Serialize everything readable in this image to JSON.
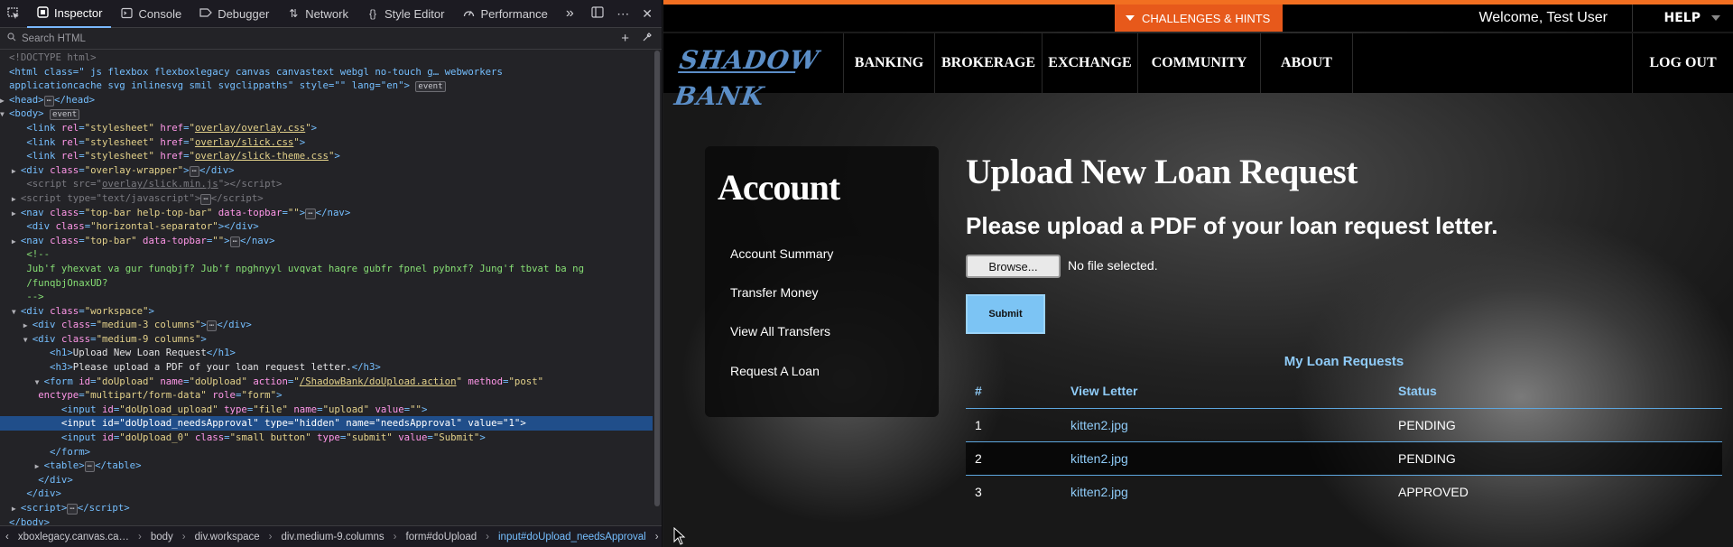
{
  "devtools": {
    "tabs": [
      {
        "label": "Inspector",
        "icon": "inspector-icon"
      },
      {
        "label": "Console",
        "icon": "console-icon"
      },
      {
        "label": "Debugger",
        "icon": "debugger-icon"
      },
      {
        "label": "Network",
        "icon": "network-icon"
      },
      {
        "label": "Style Editor",
        "icon": "style-editor-icon"
      },
      {
        "label": "Performance",
        "icon": "performance-icon"
      }
    ],
    "search_placeholder": "Search HTML",
    "tree": {
      "doctype": "<!DOCTYPE html>",
      "html_open": "<html class=\" js flexbox flexboxlegacy canvas canvastext webgl no-touch g… webworkers",
      "html_open_2": "applicationcache svg inlinesvg smil svgclippaths\" style=\"\" lang=\"en\">",
      "head": "<head>",
      "head_close": "</head>",
      "body": "<body>",
      "link1": "overlay/overlay.css",
      "link2": "overlay/slick.css",
      "link3": "overlay/slick-theme.css",
      "overlay_wrapper": "overlay-wrapper",
      "script_src": "overlay/slick.min.js",
      "script_type": "text/javascript",
      "nav1_class": "top-bar help-top-bar",
      "sep_class": "horizontal-separator",
      "nav2_class": "top-bar",
      "comment_open": "<!--",
      "comment_text_1": "Jub'f yhexvat va gur funqbjf? Jub'f npghnyyl uvqvat haqre gubfr fpnel pybnxf? Jung'f tbvat ba ng",
      "comment_text_2": "/funqbjOnaxUD?",
      "comment_close": "-->",
      "workspace_class": "workspace",
      "col3_class": "medium-3 columns",
      "col9_class": "medium-9 columns",
      "h1_text": "Upload New Loan Request",
      "h3_text": "Please upload a PDF of your loan request letter.",
      "form_id": "doUpload",
      "form_name": "doUpload",
      "form_action": "/ShadowBank/doUpload.action",
      "form_method": "post",
      "form_enctype": "multipart/form-data",
      "form_role": "form",
      "input1_id": "doUpload_upload",
      "input1_type": "file",
      "input1_name": "upload",
      "input1_value": "",
      "input2_id": "doUpload_needsApproval",
      "input2_type": "hidden",
      "input2_name": "needsApproval",
      "input2_value": "1",
      "input3_id": "doUpload_0",
      "input3_class": "small button",
      "input3_type": "submit",
      "input3_value": "Submit",
      "event_badge": "event",
      "ellipsis_badge": "⋯"
    },
    "breadcrumbs": [
      "xboxlegacy.canvas.ca…",
      "body",
      "div.workspace",
      "div.medium-9.columns",
      "form#doUpload",
      "input#doUpload_needsApproval"
    ]
  },
  "page": {
    "challenges_label": "CHALLENGES & HINTS",
    "welcome_text": "Welcome, Test User",
    "help_label": "HELP",
    "logo_text": "SHADOW BANK",
    "nav": [
      "BANKING",
      "BROKERAGE",
      "EXCHANGE",
      "COMMUNITY",
      "ABOUT"
    ],
    "logout_label": "LOG OUT",
    "account": {
      "title": "Account",
      "links": [
        "Account Summary",
        "Transfer Money",
        "View All Transfers",
        "Request A Loan"
      ]
    },
    "main": {
      "heading": "Upload New Loan Request",
      "subheading": "Please upload a PDF of your loan request letter.",
      "browse_label": "Browse...",
      "file_status": "No file selected.",
      "submit_label": "Submit"
    },
    "loans": {
      "caption": "My Loan Requests",
      "columns": [
        "#",
        "View Letter",
        "Status"
      ],
      "rows": [
        {
          "num": "1",
          "letter": "kitten2.jpg",
          "status": "PENDING"
        },
        {
          "num": "2",
          "letter": "kitten2.jpg",
          "status": "PENDING"
        },
        {
          "num": "3",
          "letter": "kitten2.jpg",
          "status": "APPROVED"
        }
      ]
    },
    "colors": {
      "orange": "#e7591b",
      "accent_blue": "#8fcbf7",
      "button_blue": "#7cc4f4"
    }
  }
}
